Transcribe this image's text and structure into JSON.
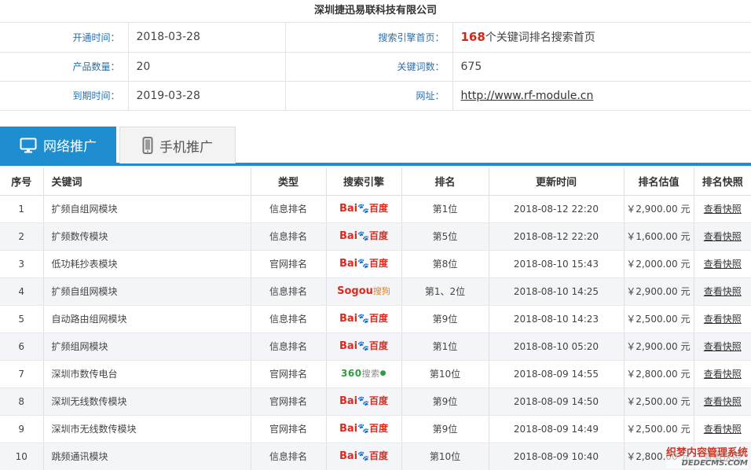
{
  "company": "深圳捷迅易联科技有限公司",
  "info": {
    "open_time": {
      "label": "开通时间：",
      "value": "2018-03-28"
    },
    "engine_home": {
      "label": "搜索引擎首页：",
      "count": "168",
      "text": "个关键词排名搜索首页"
    },
    "product_count": {
      "label": "产品数量：",
      "value": "20"
    },
    "keyword_count": {
      "label": "关键词数：",
      "value": "675"
    },
    "expire_time": {
      "label": "到期时间：",
      "value": "2019-03-28"
    },
    "website": {
      "label": "网址：",
      "value": "http://www.rf-module.cn"
    }
  },
  "tabs": [
    {
      "label": "网络推广",
      "icon": "monitor-icon",
      "active": true
    },
    {
      "label": "手机推广",
      "icon": "mobile-phone-icon",
      "active": false
    }
  ],
  "columns": [
    "序号",
    "关键词",
    "类型",
    "搜索引擎",
    "排名",
    "更新时间",
    "排名估值",
    "排名快照"
  ],
  "rows": [
    {
      "no": "1",
      "keyword": "扩频自组网模块",
      "type": "信息排名",
      "engine": "baidu",
      "rank": "第1位",
      "updated": "2018-08-12 22:20",
      "value": "￥2,900.00 元",
      "snapshot": "查看快照"
    },
    {
      "no": "2",
      "keyword": "扩频数传模块",
      "type": "信息排名",
      "engine": "baidu",
      "rank": "第5位",
      "updated": "2018-08-12 22:20",
      "value": "￥1,600.00 元",
      "snapshot": "查看快照"
    },
    {
      "no": "3",
      "keyword": "低功耗抄表模块",
      "type": "官网排名",
      "engine": "baidu",
      "rank": "第8位",
      "updated": "2018-08-10 15:43",
      "value": "￥2,000.00 元",
      "snapshot": "查看快照"
    },
    {
      "no": "4",
      "keyword": "扩频自组网模块",
      "type": "信息排名",
      "engine": "sogou",
      "rank": "第1、2位",
      "updated": "2018-08-10 14:25",
      "value": "￥2,900.00 元",
      "snapshot": "查看快照"
    },
    {
      "no": "5",
      "keyword": "自动路由组网模块",
      "type": "信息排名",
      "engine": "baidu",
      "rank": "第9位",
      "updated": "2018-08-10 14:23",
      "value": "￥2,500.00 元",
      "snapshot": "查看快照"
    },
    {
      "no": "6",
      "keyword": "扩频组网模块",
      "type": "信息排名",
      "engine": "baidu",
      "rank": "第1位",
      "updated": "2018-08-10 05:20",
      "value": "￥2,900.00 元",
      "snapshot": "查看快照"
    },
    {
      "no": "7",
      "keyword": "深圳市数传电台",
      "type": "官网排名",
      "engine": "360",
      "rank": "第10位",
      "updated": "2018-08-09 14:55",
      "value": "￥2,800.00 元",
      "snapshot": "查看快照"
    },
    {
      "no": "8",
      "keyword": "深圳无线数传模块",
      "type": "官网排名",
      "engine": "baidu",
      "rank": "第9位",
      "updated": "2018-08-09 14:50",
      "value": "￥2,500.00 元",
      "snapshot": "查看快照"
    },
    {
      "no": "9",
      "keyword": "深圳市无线数传模块",
      "type": "官网排名",
      "engine": "baidu",
      "rank": "第9位",
      "updated": "2018-08-09 14:49",
      "value": "￥2,500.00 元",
      "snapshot": "查看快照"
    },
    {
      "no": "10",
      "keyword": "跳频通讯模块",
      "type": "信息排名",
      "engine": "baidu",
      "rank": "第10位",
      "updated": "2018-08-09 10:40",
      "value": "￥2,800.00 元",
      "snapshot": "查看快照"
    }
  ],
  "logos": {
    "baidu": {
      "a": "Bai",
      "b": "百度"
    },
    "sogou": {
      "a": "Sogou",
      "b": "搜狗"
    },
    "360": {
      "a": "360",
      "b": "搜索"
    }
  },
  "watermark": {
    "line1": "织梦内容管理系统",
    "line2": "DEDECMS.COM"
  },
  "colors": {
    "accent": "#1f8ed1",
    "rank_red": "#d9241c",
    "label_blue": "#2a6fb0"
  }
}
